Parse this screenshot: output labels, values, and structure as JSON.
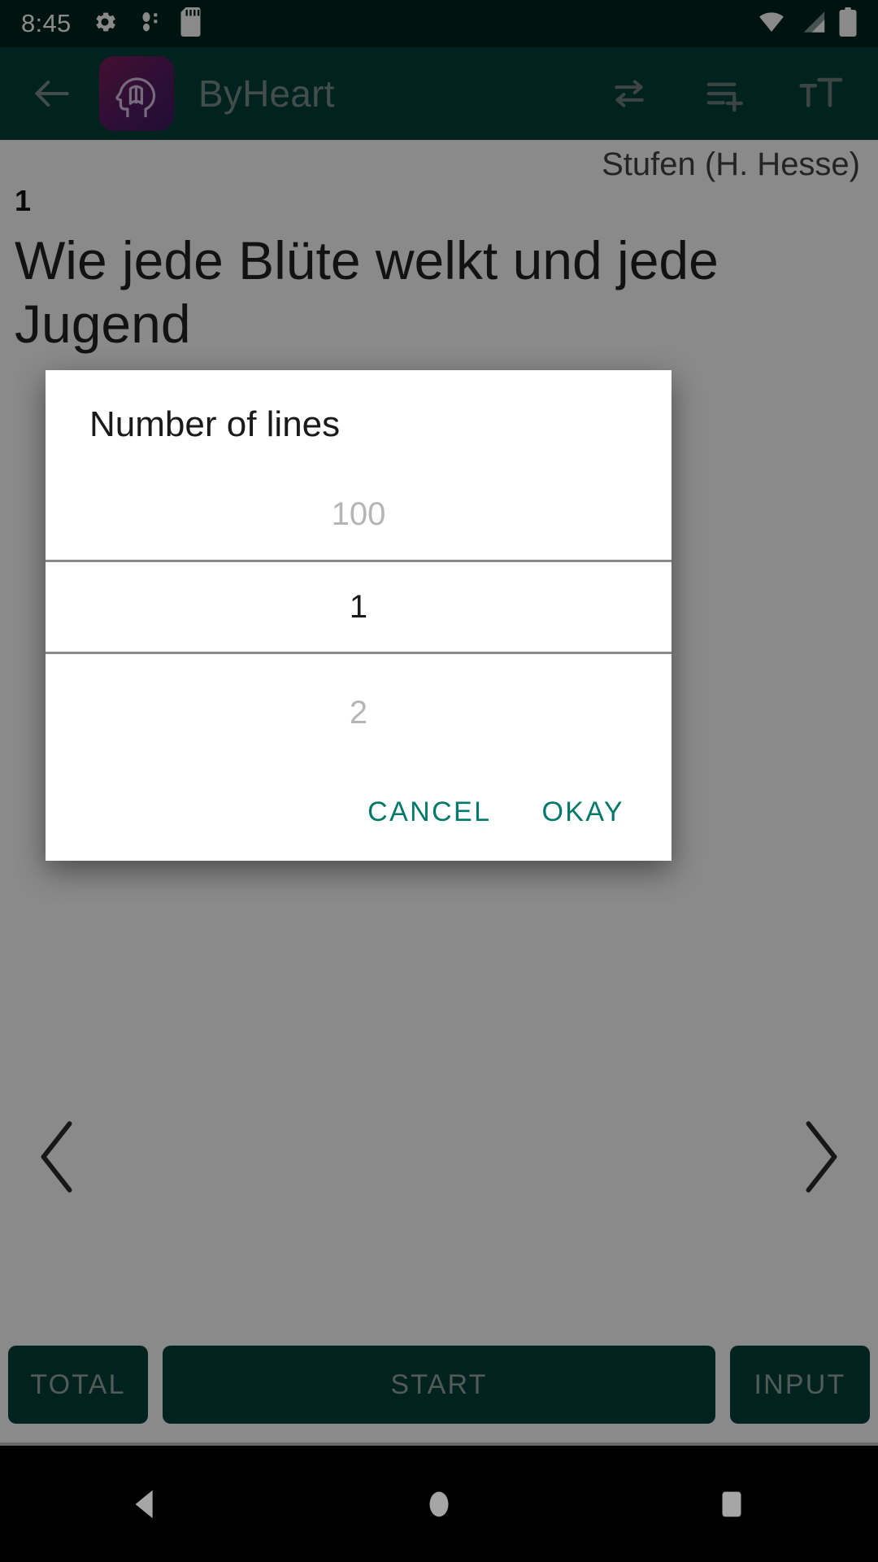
{
  "status_bar": {
    "time": "8:45",
    "icons": [
      "gear-icon",
      "bluetooth-audio-icon",
      "sd-card-icon"
    ],
    "right_icons": [
      "wifi-icon",
      "cellular-signal-icon",
      "battery-icon"
    ],
    "background_color": "#00251c"
  },
  "app_bar": {
    "back_label": "back-arrow",
    "title": "ByHeart",
    "logo_alt": "head-with-book-logo",
    "actions": [
      "swap-arrows-icon",
      "playlist-add-icon",
      "text-size-icon"
    ],
    "background_color": "#00413a"
  },
  "content": {
    "source": "Stufen (H. Hesse)",
    "line_number": "1",
    "line_text": "Wie jede Blüte welkt und jede Jugend",
    "prev_label": "previous-chevron",
    "next_label": "next-chevron"
  },
  "bottom_bar": {
    "total_label": "TOTAL",
    "start_label": "START",
    "input_label": "INPUT",
    "button_color": "#00413a",
    "text_color": "#9aa8a5"
  },
  "dialog": {
    "title": "Number of lines",
    "picker": {
      "previous_value": "100",
      "selected_value": "1",
      "next_value": "2"
    },
    "cancel_label": "CANCEL",
    "okay_label": "OKAY",
    "accent_color": "#00796b"
  },
  "nav_bar": {
    "back_label": "nav-back-triangle",
    "home_label": "nav-home-circle",
    "recents_label": "nav-recents-square",
    "background_color": "#000000"
  }
}
